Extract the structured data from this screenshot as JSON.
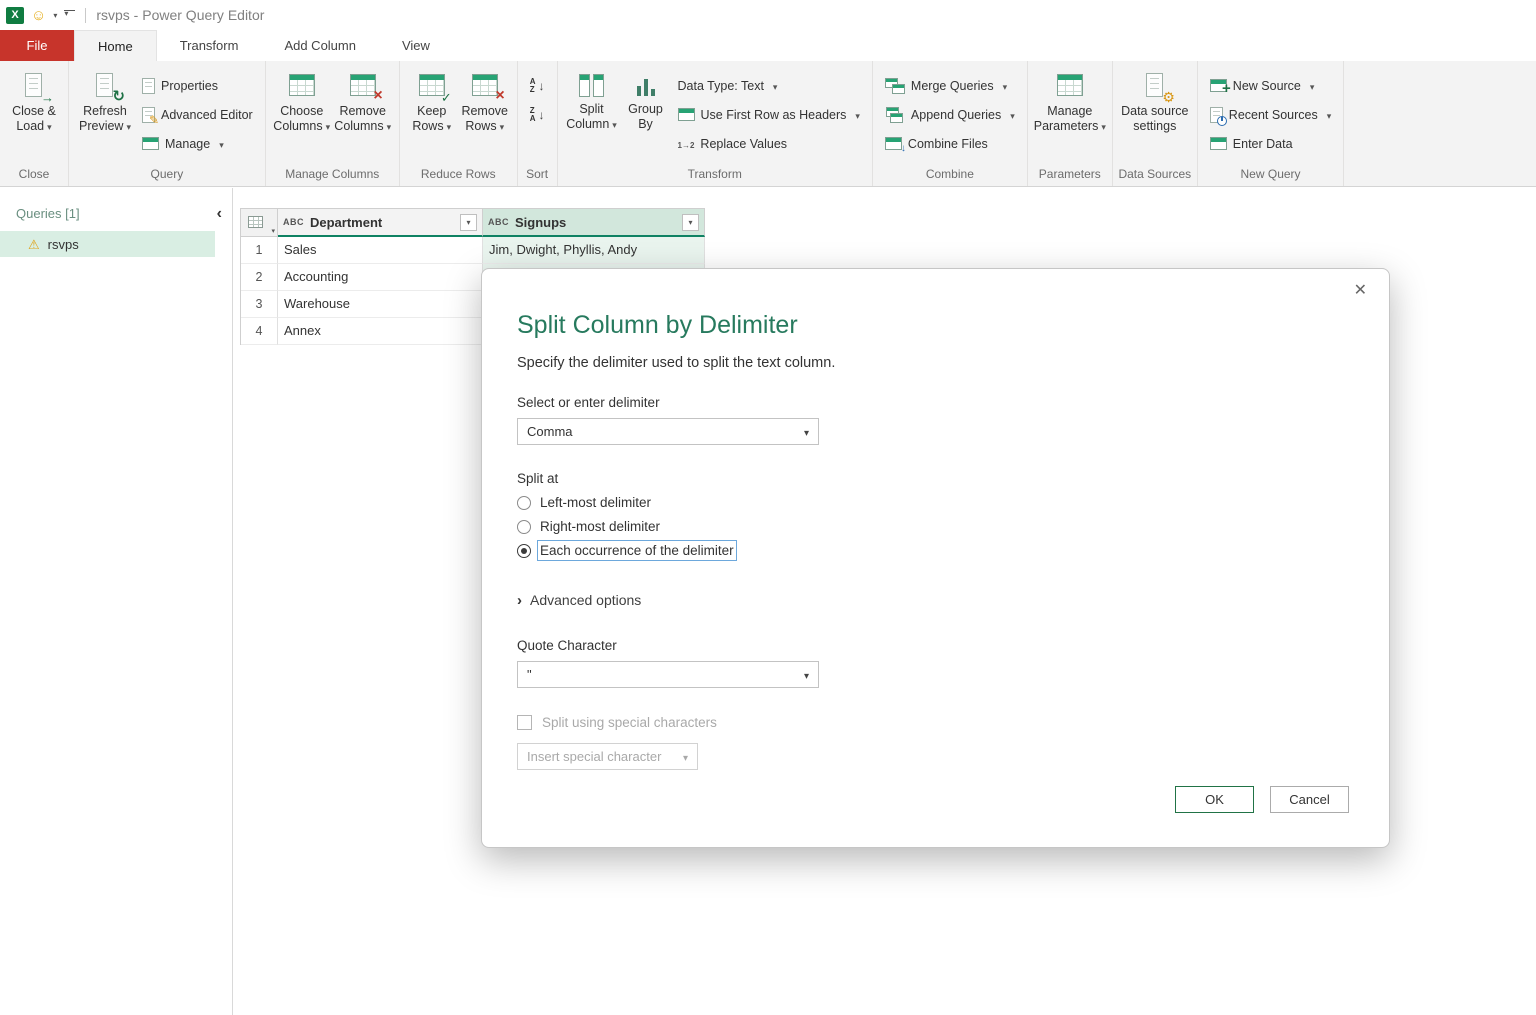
{
  "titlebar": {
    "title": "rsvps - Power Query Editor"
  },
  "tabs": {
    "file": "File",
    "items": [
      "Home",
      "Transform",
      "Add Column",
      "View"
    ],
    "active": "Home"
  },
  "ribbon": {
    "close_group": {
      "caption": "Close",
      "close_load": "Close & Load"
    },
    "query_group": {
      "caption": "Query",
      "refresh_preview": "Refresh Preview",
      "properties": "Properties",
      "advanced_editor": "Advanced Editor",
      "manage": "Manage"
    },
    "manage_columns_group": {
      "caption": "Manage Columns",
      "choose_columns": "Choose Columns",
      "remove_columns": "Remove Columns"
    },
    "reduce_rows_group": {
      "caption": "Reduce Rows",
      "keep_rows": "Keep Rows",
      "remove_rows": "Remove Rows"
    },
    "sort_group": {
      "caption": "Sort"
    },
    "transform_group": {
      "caption": "Transform",
      "split_column": "Split Column",
      "group_by": "Group By",
      "data_type": "Data Type: Text",
      "use_first_row": "Use First Row as Headers",
      "replace_values": "Replace Values"
    },
    "combine_group": {
      "caption": "Combine",
      "merge_queries": "Merge Queries",
      "append_queries": "Append Queries",
      "combine_files": "Combine Files"
    },
    "parameters_group": {
      "caption": "Parameters",
      "manage_parameters": "Manage Parameters"
    },
    "data_sources_group": {
      "caption": "Data Sources",
      "settings": "Data source settings"
    },
    "new_query_group": {
      "caption": "New Query",
      "new_source": "New Source",
      "recent_sources": "Recent Sources",
      "enter_data": "Enter Data"
    }
  },
  "sidebar": {
    "header": "Queries [1]",
    "items": [
      {
        "label": "rsvps",
        "warning": true
      }
    ]
  },
  "grid": {
    "columns": [
      {
        "type": "ABC",
        "label": "Department",
        "selected": false
      },
      {
        "type": "ABC",
        "label": "Signups",
        "selected": true
      }
    ],
    "rows": [
      {
        "n": "1",
        "cells": [
          "Sales",
          "Jim, Dwight, Phyllis, Andy"
        ]
      },
      {
        "n": "2",
        "cells": [
          "Accounting",
          ""
        ]
      },
      {
        "n": "3",
        "cells": [
          "Warehouse",
          ""
        ]
      },
      {
        "n": "4",
        "cells": [
          "Annex",
          ""
        ]
      }
    ]
  },
  "dialog": {
    "title": "Split Column by Delimiter",
    "subtitle": "Specify the delimiter used to split the text column.",
    "delimiter_label": "Select or enter delimiter",
    "delimiter_value": "Comma",
    "split_at_label": "Split at",
    "radios": [
      {
        "label": "Left-most delimiter",
        "checked": false
      },
      {
        "label": "Right-most delimiter",
        "checked": false
      },
      {
        "label": "Each occurrence of the delimiter",
        "checked": true
      }
    ],
    "advanced_label": "Advanced options",
    "quote_label": "Quote Character",
    "quote_value": "\"",
    "special_checkbox_label": "Split using special characters",
    "insert_special_label": "Insert special character",
    "ok_label": "OK",
    "cancel_label": "Cancel"
  },
  "colors": {
    "accent_green": "#217346",
    "title_green": "#277a5e",
    "header_underline": "#0f8263",
    "selection_green_bg": "#d9eee3",
    "file_tab_red": "#c7342b"
  }
}
